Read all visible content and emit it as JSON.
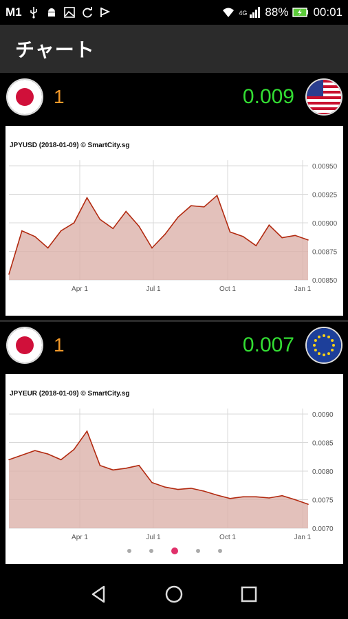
{
  "status_bar": {
    "carrier": "M1",
    "network": "4G",
    "battery": "88%",
    "time": "00:01"
  },
  "app_bar": {
    "title": "チャート"
  },
  "pairs": [
    {
      "base_currency": "JPY",
      "base_amount": "1",
      "quote_currency": "USD",
      "quote_amount": "0.009"
    },
    {
      "base_currency": "JPY",
      "base_amount": "1",
      "quote_currency": "EUR",
      "quote_amount": "0.007"
    }
  ],
  "pager": {
    "count": 5,
    "active_index": 2
  },
  "colors": {
    "line": "#b22a10",
    "fill": "#dcb2aa",
    "grid": "#d8d8d8",
    "base": "#f39a2a",
    "quote": "#33dd33",
    "dot_active": "#e0306a"
  },
  "chart_data": [
    {
      "type": "area",
      "title": "JPYUSD (2018-01-09) © SmartCity.sg",
      "x_tick_labels": [
        "Apr 1",
        "Jul 1",
        "Oct 1",
        "Jan 1"
      ],
      "y_tick_labels": [
        "0.00950",
        "0.00925",
        "0.00900",
        "0.00875",
        "0.00850"
      ],
      "ylim": [
        0.0085,
        0.0095
      ],
      "x": [
        "Jan 9",
        "Jan 25",
        "Feb 10",
        "Feb 26",
        "Mar 14",
        "Mar 30",
        "Apr 15",
        "May 1",
        "May 17",
        "Jun 2",
        "Jun 18",
        "Jul 4",
        "Jul 20",
        "Aug 5",
        "Aug 21",
        "Sep 6",
        "Sep 22",
        "Oct 8",
        "Oct 24",
        "Nov 9",
        "Nov 25",
        "Dec 11",
        "Dec 27",
        "Jan 9"
      ],
      "series": [
        {
          "values": [
            0.00855,
            0.00893,
            0.00888,
            0.00878,
            0.00893,
            0.009,
            0.00922,
            0.00903,
            0.00895,
            0.0091,
            0.00897,
            0.00878,
            0.0089,
            0.00905,
            0.00915,
            0.00914,
            0.00924,
            0.00892,
            0.00888,
            0.0088,
            0.00898,
            0.00887,
            0.00889,
            0.00885
          ]
        }
      ],
      "grid": true
    },
    {
      "type": "area",
      "title": "JPYEUR (2018-01-09) © SmartCity.sg",
      "x_tick_labels": [
        "Apr 1",
        "Jul 1",
        "Oct 1",
        "Jan 1"
      ],
      "y_tick_labels": [
        "0.0090",
        "0.0085",
        "0.0080",
        "0.0075",
        "0.0070"
      ],
      "ylim": [
        0.007,
        0.009
      ],
      "x": [
        "Jan 9",
        "Jan 25",
        "Feb 10",
        "Feb 26",
        "Mar 14",
        "Mar 30",
        "Apr 15",
        "May 1",
        "May 17",
        "Jun 2",
        "Jun 18",
        "Jul 4",
        "Jul 20",
        "Aug 5",
        "Aug 21",
        "Sep 6",
        "Sep 22",
        "Oct 8",
        "Oct 24",
        "Nov 9",
        "Nov 25",
        "Dec 11",
        "Dec 27",
        "Jan 9"
      ],
      "series": [
        {
          "values": [
            0.0082,
            0.00828,
            0.00836,
            0.0083,
            0.0082,
            0.00838,
            0.0087,
            0.0081,
            0.00802,
            0.00805,
            0.0081,
            0.0078,
            0.00772,
            0.00768,
            0.0077,
            0.00765,
            0.00758,
            0.00752,
            0.00755,
            0.00755,
            0.00753,
            0.00757,
            0.0075,
            0.00742
          ]
        }
      ],
      "grid": true
    }
  ]
}
